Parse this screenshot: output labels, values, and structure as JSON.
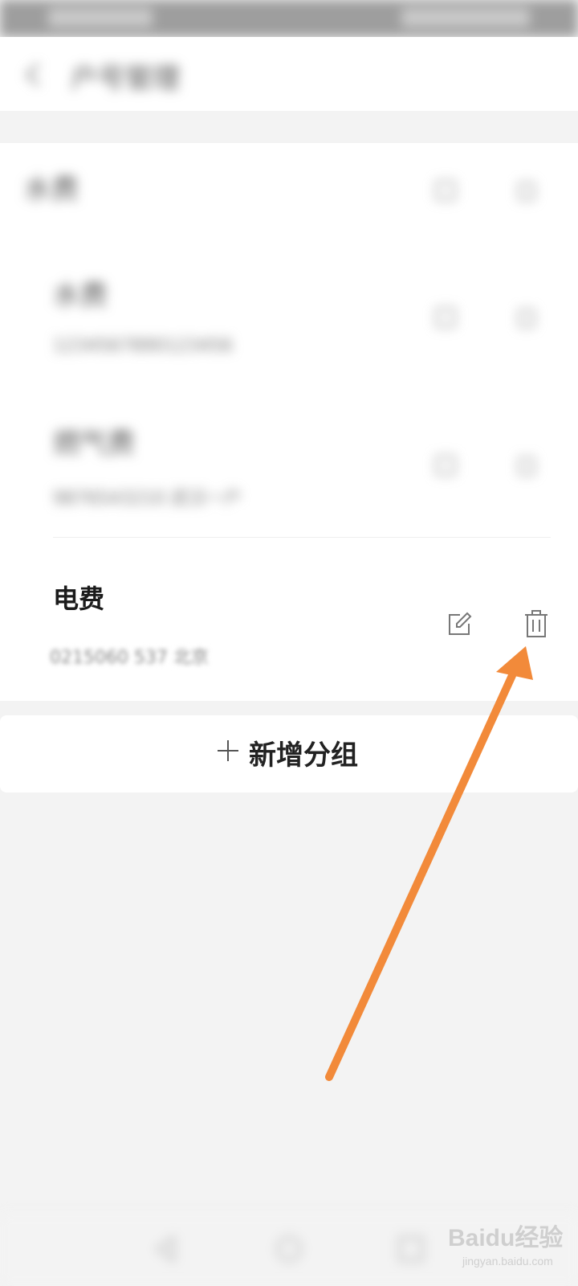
{
  "header": {
    "title": "户号管理"
  },
  "group": {
    "title": "水费",
    "items": [
      {
        "name": "水费",
        "account": "1234567890123456"
      },
      {
        "name": "燃气费",
        "account": "9876543210 武汉一户"
      }
    ]
  },
  "electricity_item": {
    "name": "电费",
    "account": "0215060 537 北京"
  },
  "add_group": {
    "plus": "+",
    "label": "新增分组"
  },
  "watermark": {
    "brand": "Baidu经验",
    "url": "jingyan.baidu.com"
  },
  "colors": {
    "arrow": "#f28a3a",
    "background": "#f3f3f3",
    "card": "#ffffff"
  }
}
